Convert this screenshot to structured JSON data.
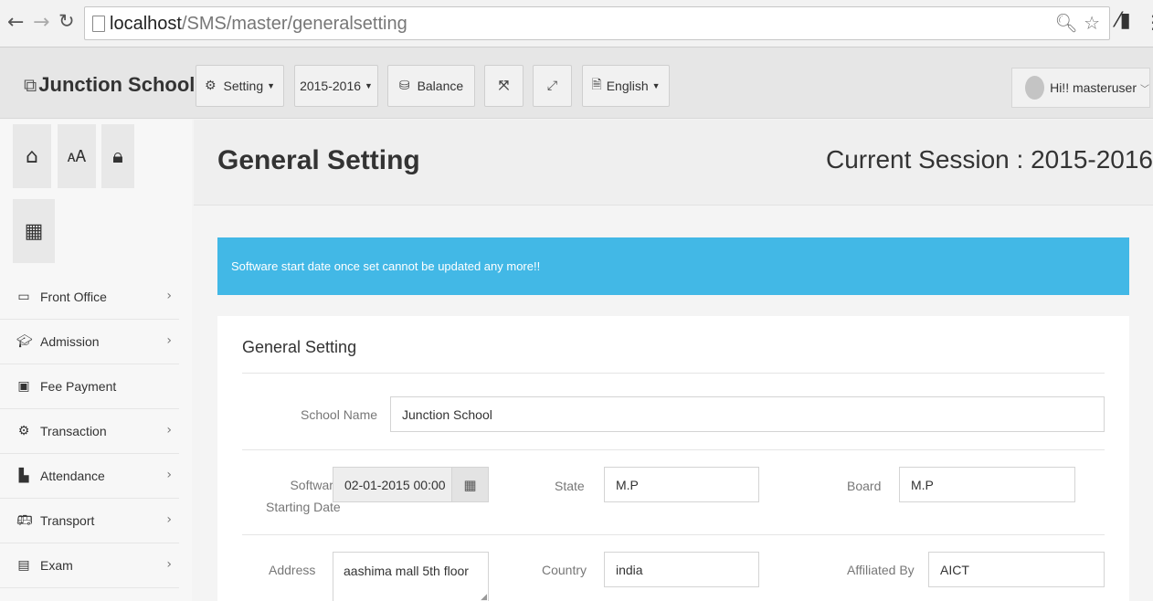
{
  "browser": {
    "url_host": "localhost",
    "url_path": "/SMS/master/generalsetting",
    "back_icon": "arrow-left",
    "forward_icon": "arrow-right",
    "reload_icon": "reload",
    "search_icon": "magnifier",
    "star_icon": "star"
  },
  "topbar": {
    "brand": "Junction School",
    "setting_label": "Setting",
    "session_label": "2015-2016",
    "balance_label": "Balance",
    "language_label": "English",
    "user_greeting": "Hi!! masteruser"
  },
  "sidebar": {
    "items": [
      {
        "label": "Front Office",
        "icon": "monitor-icon",
        "has_arrow": true
      },
      {
        "label": "Admission",
        "icon": "graduation-cap-icon",
        "has_arrow": true
      },
      {
        "label": "Fee Payment",
        "icon": "money-icon",
        "has_arrow": false
      },
      {
        "label": "Transaction",
        "icon": "gear-icon",
        "has_arrow": true
      },
      {
        "label": "Attendance",
        "icon": "bar-chart-icon",
        "has_arrow": true
      },
      {
        "label": "Transport",
        "icon": "bus-icon",
        "has_arrow": true
      },
      {
        "label": "Exam",
        "icon": "file-icon",
        "has_arrow": true
      }
    ]
  },
  "header": {
    "page_title": "General Setting",
    "current_session": "Current Session : 2015-2016"
  },
  "alert": {
    "message": "Software start date once set cannot be updated any more!!",
    "color": "#42b8e6"
  },
  "form": {
    "panel_title": "General Setting",
    "school_name_label": "School Name",
    "school_name_value": "Junction School",
    "start_date_label_1": "Software",
    "start_date_label_2": "Starting Date",
    "start_date_value": "02-01-2015 00:00",
    "state_label": "State",
    "state_value": "M.P",
    "board_label": "Board",
    "board_value": "M.P",
    "address_label": "Address",
    "address_value": "aashima mall 5th floor",
    "country_label": "Country",
    "country_value": "india",
    "affiliated_label": "Affiliated By",
    "affiliated_value": "AICT"
  }
}
